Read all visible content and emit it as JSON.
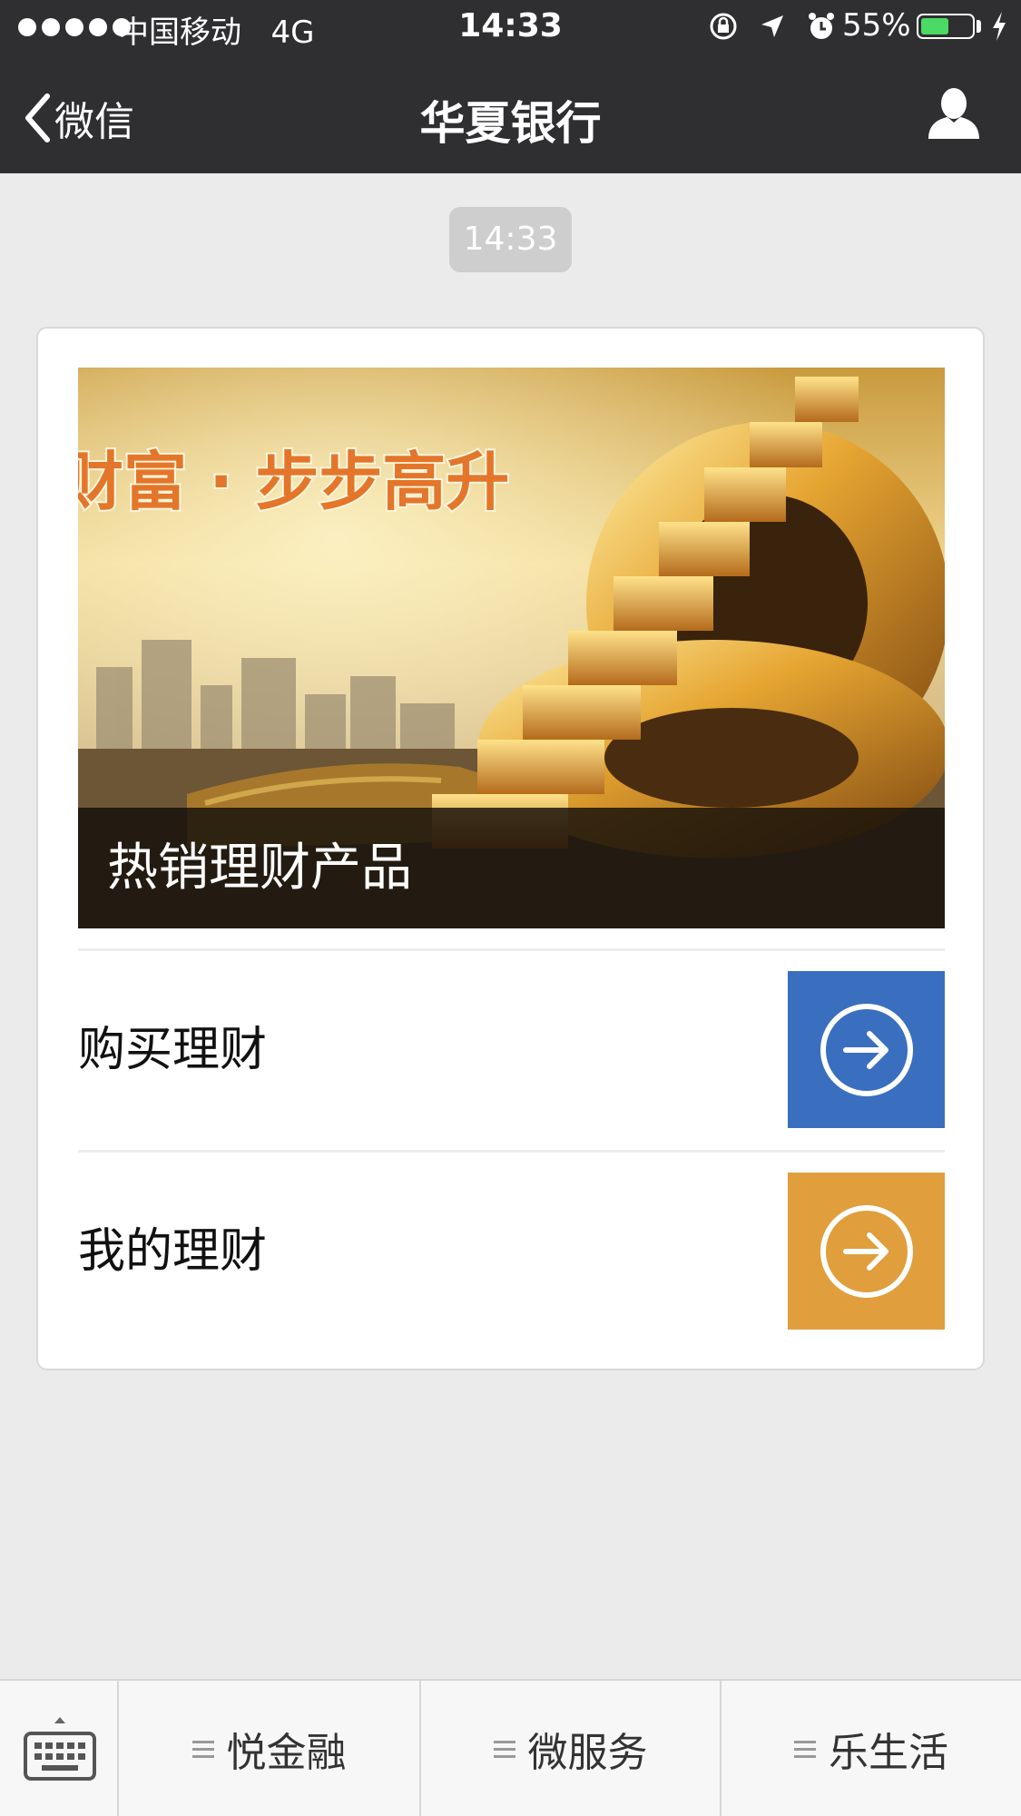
{
  "status_bar": {
    "carrier": "中国移动",
    "network": "4G",
    "time": "14:33",
    "battery_percent": "55%",
    "battery_level": 0.55
  },
  "nav": {
    "back_label": "微信",
    "title": "华夏银行"
  },
  "chat": {
    "timestamp": "14:33"
  },
  "card": {
    "banner_slogan": "财富 · 步步高升",
    "banner_caption": "热销理财产品",
    "items": [
      {
        "label": "购买理财",
        "button_color": "#3a6ebf"
      },
      {
        "label": "我的理财",
        "button_color": "#e09e3c"
      }
    ]
  },
  "bottom_menu": {
    "tabs": [
      {
        "label": "悦金融"
      },
      {
        "label": "微服务"
      },
      {
        "label": "乐生活"
      }
    ]
  },
  "colors": {
    "nav_bg": "#2f2f31",
    "page_bg": "#ebebeb",
    "battery_green": "#4cd964"
  }
}
